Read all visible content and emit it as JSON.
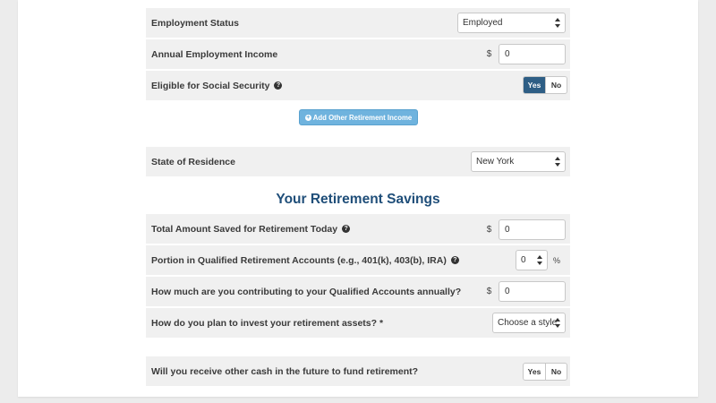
{
  "employment_status": {
    "label": "Employment Status",
    "value": "Employed"
  },
  "annual_income": {
    "label": "Annual Employment Income",
    "prefix": "$",
    "value": "0"
  },
  "social_security": {
    "label": "Eligible for Social Security",
    "yes": "Yes",
    "no": "No",
    "selected": "Yes"
  },
  "add_income_button": {
    "label": "Add Other Retirement Income"
  },
  "state": {
    "label": "State of Residence",
    "value": "New York"
  },
  "savings_section": {
    "title": "Your Retirement Savings",
    "total_saved": {
      "label": "Total Amount Saved for Retirement Today",
      "prefix": "$",
      "value": "0"
    },
    "qualified_portion": {
      "label": "Portion in Qualified Retirement Accounts (e.g., 401(k), 403(b), IRA)",
      "value": "0",
      "suffix": "%"
    },
    "annual_contribution": {
      "label": "How much are you contributing to your Qualified Accounts annually?",
      "prefix": "$",
      "value": "0"
    },
    "invest_style": {
      "label": "How do you plan to invest your retirement assets? *",
      "value": "Choose a style"
    },
    "other_cash": {
      "label": "Will you receive other cash in the future to fund retirement?",
      "yes": "Yes",
      "no": "No",
      "selected": ""
    }
  },
  "colors": {
    "primary": "#2e5e85",
    "accent": "#6fb3de",
    "title": "#1f4e79",
    "row_bg": "#f0f0f0"
  }
}
